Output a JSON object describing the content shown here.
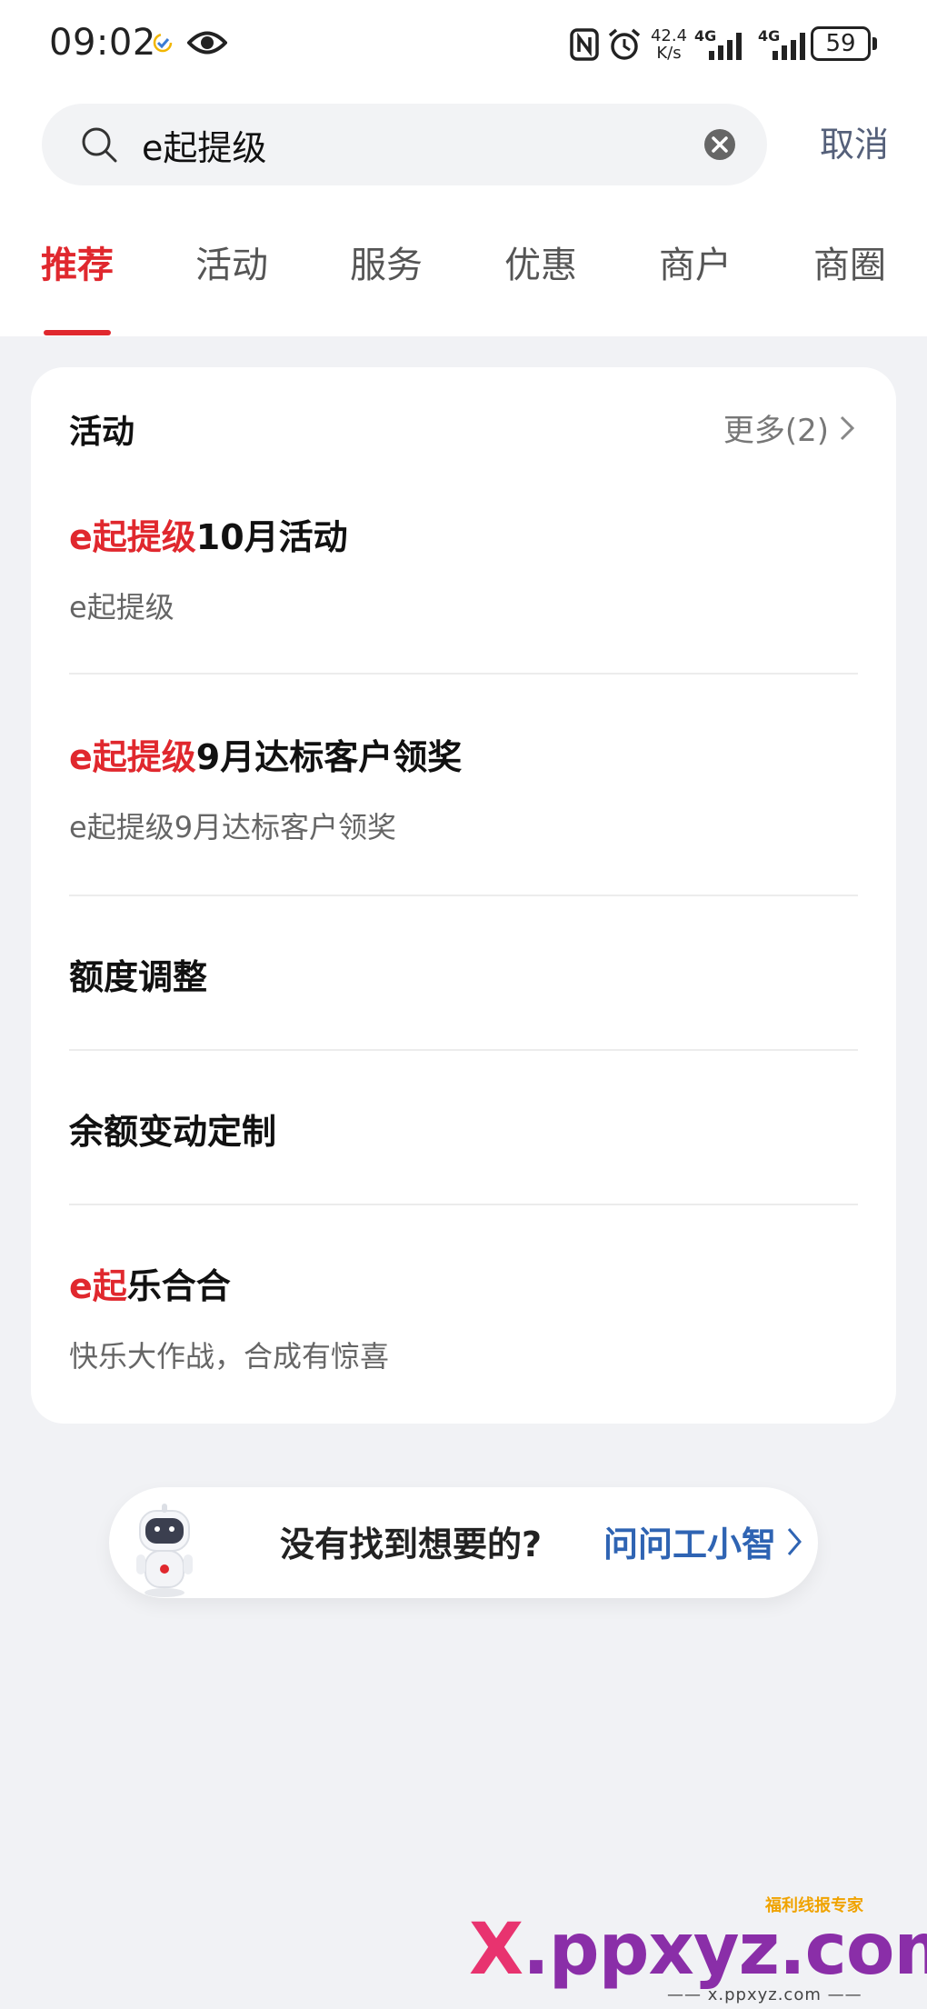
{
  "status_bar": {
    "time": "09:02",
    "net_speed_top": "42.4",
    "net_speed_bottom": "K/s",
    "net_type_1": "4G",
    "net_type_2": "4G",
    "battery": "59"
  },
  "search": {
    "query": "e起提级",
    "cancel_label": "取消"
  },
  "tabs": [
    {
      "label": "推荐",
      "active": true
    },
    {
      "label": "活动",
      "active": false
    },
    {
      "label": "服务",
      "active": false
    },
    {
      "label": "优惠",
      "active": false
    },
    {
      "label": "商户",
      "active": false
    },
    {
      "label": "商圈",
      "active": false
    }
  ],
  "section": {
    "title": "活动",
    "more_label": "更多(2)"
  },
  "results": [
    {
      "highlight": "e起提级",
      "rest": "10月活动",
      "subtitle": "e起提级"
    },
    {
      "highlight": "e起提级",
      "rest": "9月达标客户领奖",
      "subtitle": "e起提级9月达标客户领奖"
    },
    {
      "highlight": "",
      "rest": "额度调整",
      "subtitle": ""
    },
    {
      "highlight": "",
      "rest": "余额变动定制",
      "subtitle": ""
    },
    {
      "highlight": "e起",
      "rest": "乐合合",
      "subtitle": "快乐大作战，合成有惊喜"
    }
  ],
  "ask": {
    "prompt": "没有找到想要的?",
    "link_label": "问问工小智"
  },
  "watermark": {
    "logo_x": "X",
    "logo_rest": ".ppxyz.com",
    "tagline": "福利线报专家",
    "url": "—— x.ppxyz.com ——"
  },
  "colors": {
    "accent_red": "#e0282e",
    "link_blue": "#2f64b3",
    "background": "#f1f2f5"
  }
}
